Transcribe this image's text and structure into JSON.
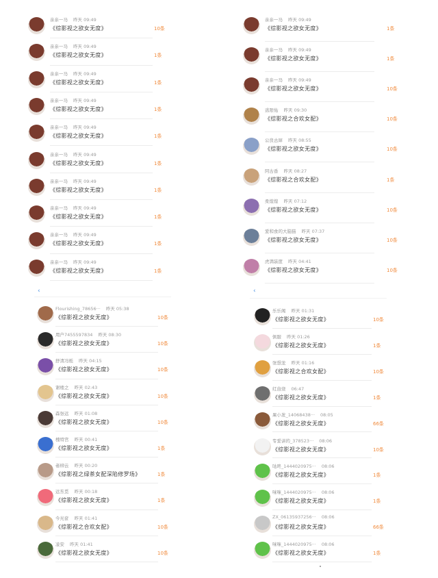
{
  "back_label": "‹",
  "panels": [
    {
      "rows": [
        {
          "user": "亲亲一马",
          "time": "昨天 09:49",
          "title": "《综影视之欲女无度》",
          "count": "10条",
          "color": "#7a3b2e"
        },
        {
          "user": "亲亲一马",
          "time": "昨天 09:49",
          "title": "《综影视之欲女无度》",
          "count": "1条",
          "color": "#7a3b2e"
        },
        {
          "user": "亲亲一马",
          "time": "昨天 09:49",
          "title": "《综影视之欲女无度》",
          "count": "1条",
          "color": "#7a3b2e"
        },
        {
          "user": "亲亲一马",
          "time": "昨天 09:49",
          "title": "《综影视之欲女无度》",
          "count": "1条",
          "color": "#7a3b2e"
        },
        {
          "user": "亲亲一马",
          "time": "昨天 09:49",
          "title": "《综影视之欲女无度》",
          "count": "1条",
          "color": "#7a3b2e"
        },
        {
          "user": "亲亲一马",
          "time": "昨天 09:49",
          "title": "《综影视之欲女无度》",
          "count": "1条",
          "color": "#7a3b2e"
        },
        {
          "user": "亲亲一马",
          "time": "昨天 09:49",
          "title": "《综影视之欲女无度》",
          "count": "1条",
          "color": "#7a3b2e"
        },
        {
          "user": "亲亲一马",
          "time": "昨天 09:49",
          "title": "《综影视之欲女无度》",
          "count": "1条",
          "color": "#7a3b2e"
        },
        {
          "user": "亲亲一马",
          "time": "昨天 09:49",
          "title": "《综影视之欲女无度》",
          "count": "1条",
          "color": "#7a3b2e"
        },
        {
          "user": "亲亲一马",
          "time": "昨天 09:49",
          "title": "《综影视之欲女无度》",
          "count": "1条",
          "color": "#7a3b2e"
        }
      ]
    },
    {
      "rows": [
        {
          "user": "亲亲一马",
          "time": "昨天 09:49",
          "title": "《综影视之欲女无度》",
          "count": "1条",
          "color": "#7a3b2e"
        },
        {
          "user": "亲亲一马",
          "time": "昨天 09:49",
          "title": "《综影视之欲女无度》",
          "count": "1条",
          "color": "#7a3b2e"
        },
        {
          "user": "亲亲一马",
          "time": "昨天 09:49",
          "title": "《综影视之欲女无度》",
          "count": "10条",
          "color": "#7a3b2e"
        },
        {
          "user": "逃限佑",
          "time": "昨天 09:30",
          "title": "《综影视之合欢女配》",
          "count": "10条",
          "color": "#b0824a"
        },
        {
          "user": "公良古犀",
          "time": "昨天 08:55",
          "title": "《综影视之欲女无度》",
          "count": "10条",
          "color": "#8aa0c8"
        },
        {
          "user": "阿古香",
          "time": "昨天 08:27",
          "title": "《综影视之合欢女配》",
          "count": "1条",
          "color": "#c9a27a"
        },
        {
          "user": "柔煌煌",
          "time": "昨天 07:12",
          "title": "《综影视之欲女无度》",
          "count": "10条",
          "color": "#8c6fb0"
        },
        {
          "user": "爱和食的大脑猫",
          "time": "昨天 07:37",
          "title": "《综影视之欲女无度》",
          "count": "10条",
          "color": "#6c7f99"
        },
        {
          "user": "虎満装度",
          "time": "昨天 04:41",
          "title": "《综影视之欲女无度》",
          "count": "10条",
          "color": "#c07fa8"
        }
      ]
    },
    {
      "rows": [
        {
          "user": "Flourishing_78656···",
          "time": "昨天 05:38",
          "title": "《综影视之欲女无度》",
          "count": "10条",
          "color": "#a06a4a"
        },
        {
          "user": "用户7455597834",
          "time": "昨天 08:30",
          "title": "《综影视之欲女无度》",
          "count": "10条",
          "color": "#2a2a2a"
        },
        {
          "user": "舒清冯栀",
          "time": "昨天 04:15",
          "title": "《综影视之欲女无度》",
          "count": "10条",
          "color": "#7a4fa8"
        },
        {
          "user": "谢楼之",
          "time": "昨天 02:43",
          "title": "《综影视之欲女无度》",
          "count": "10条",
          "color": "#e3c58f"
        },
        {
          "user": "森张远",
          "time": "昨天 01:08",
          "title": "《综影视之欲女无度》",
          "count": "10条",
          "color": "#4a3a36"
        },
        {
          "user": "槐特宫",
          "time": "昨天 00:41",
          "title": "《综影视之欲女无度》",
          "count": "1条",
          "color": "#3a6fd0"
        },
        {
          "user": "者柳云",
          "time": "昨天 00:20",
          "title": "《综影视之绿茶女配深陷修罗场》",
          "count": "1条",
          "color": "#b89a88"
        },
        {
          "user": "远东觅",
          "time": "昨天 00:18",
          "title": "《综影视之欲女无度》",
          "count": "1条",
          "color": "#f06a7a"
        },
        {
          "user": "今光奁",
          "time": "昨天 01:41",
          "title": "《综影视之合欢女配》",
          "count": "10条",
          "color": "#d9b88a"
        },
        {
          "user": "凌安",
          "time": "昨天 01:41",
          "title": "《综影视之欲女无度》",
          "count": "10条",
          "color": "#4a6a3a"
        }
      ]
    },
    {
      "rows": [
        {
          "user": "乐乐阁",
          "time": "昨天 01:31",
          "title": "《综影视之欲女无度》",
          "count": "10条",
          "color": "#222222"
        },
        {
          "user": "佩服",
          "time": "昨天 01:26",
          "title": "《综影视之欲女无度》",
          "count": "1条",
          "color": "#f4d9de"
        },
        {
          "user": "张想龙",
          "time": "昨天 01:16",
          "title": "《综影视之合欢女配》",
          "count": "10条",
          "color": "#e0a040"
        },
        {
          "user": "红自烧",
          "time": "06:47",
          "title": "《综影视之欲女无度》",
          "count": "1条",
          "color": "#6f6f6f"
        },
        {
          "user": "果小发_14068438···",
          "time": "08:05",
          "title": "《综影视之欲女无度》",
          "count": "66条",
          "color": "#8a5a3a"
        },
        {
          "user": "专爱讲的_378523···",
          "time": "08:06",
          "title": "《综影视之欲女无度》",
          "count": "10条",
          "color": "#f2f2f2"
        },
        {
          "user": "咕咚_1444020975···",
          "time": "08:06",
          "title": "《综影视之欲女无度》",
          "count": "1条",
          "color": "#5fc24a"
        },
        {
          "user": "咪咪_1444020975···",
          "time": "08:06",
          "title": "《综影视之欲女无度》",
          "count": "1条",
          "color": "#5fc24a"
        },
        {
          "user": "ZX_06135937256···",
          "time": "08:06",
          "title": "《综影视之欲女无度》",
          "count": "66条",
          "color": "#c8c8c8"
        },
        {
          "user": "咪咪_1444020975···",
          "time": "08:06",
          "title": "《综影视之欲女无度》",
          "count": "1条",
          "color": "#5fc24a"
        }
      ]
    }
  ]
}
